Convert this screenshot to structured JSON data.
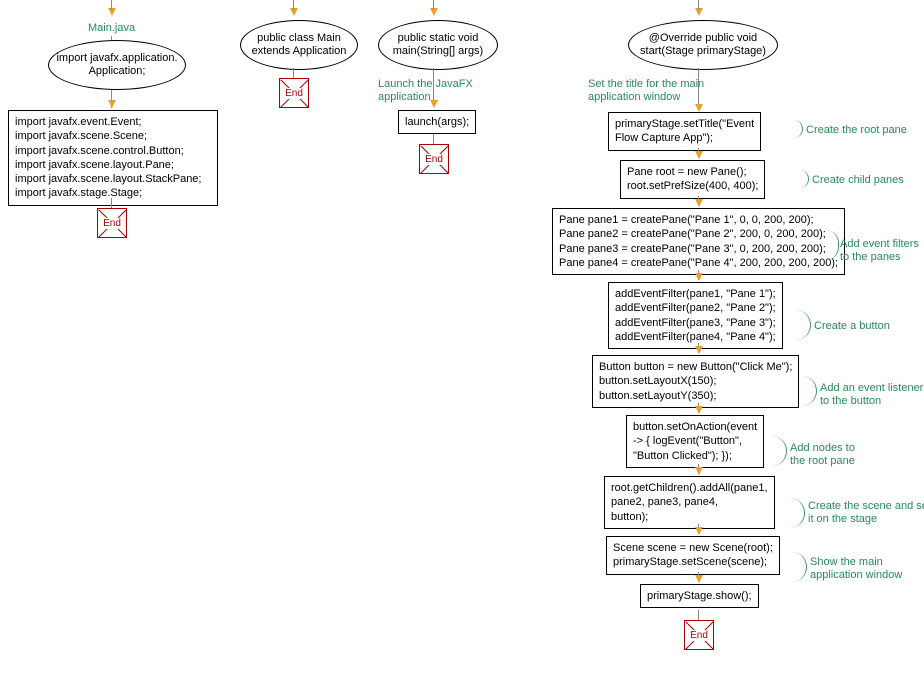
{
  "columns": {
    "col1": {
      "title": "Main.java",
      "ellipse": "import javafx.application.\nApplication;",
      "box": "import javafx.event.Event;\nimport javafx.scene.Scene;\nimport javafx.scene.control.Button;\nimport javafx.scene.layout.Pane;\nimport javafx.scene.layout.StackPane;\nimport javafx.stage.Stage;",
      "end": "End"
    },
    "col2": {
      "ellipse": "public class Main\nextends Application",
      "end": "End"
    },
    "col3": {
      "ellipse": "public static void\nmain(String[] args)",
      "comment": "Launch the JavaFX\napplication",
      "box": "launch(args);",
      "end": "End"
    },
    "col4": {
      "ellipse": "@Override public void\nstart(Stage primaryStage)",
      "c1": "Set the title for the main\napplication window",
      "b1": "primaryStage.setTitle(\"Event\nFlow Capture App\");",
      "c2": "Create the root pane",
      "b2": "Pane root = new Pane();\nroot.setPrefSize(400, 400);",
      "c3": "Create child panes",
      "b3": "Pane pane1 = createPane(\"Pane 1\", 0, 0, 200, 200);\nPane pane2 = createPane(\"Pane 2\", 200, 0, 200, 200);\nPane pane3 = createPane(\"Pane 3\", 0, 200, 200, 200);\nPane pane4 = createPane(\"Pane 4\", 200, 200, 200, 200);",
      "c4": "Add event filters\nto the panes",
      "b4": "addEventFilter(pane1, \"Pane 1\");\naddEventFilter(pane2, \"Pane 2\");\naddEventFilter(pane3, \"Pane 3\");\naddEventFilter(pane4, \"Pane 4\");",
      "c5": "Create a button",
      "b5": "Button button = new Button(\"Click Me\");\nbutton.setLayoutX(150);\nbutton.setLayoutY(350);",
      "c6": "Add an event listener\nto the button",
      "b6": "button.setOnAction(event\n-> { logEvent(\"Button\",\n\"Button Clicked\"); });",
      "c7": "Add nodes to\nthe root pane",
      "b7": "root.getChildren().addAll(pane1,\npane2, pane3, pane4,\nbutton);",
      "c8": "Create the scene and set\nit on the stage",
      "b8": "Scene scene = new Scene(root);\nprimaryStage.setScene(scene);",
      "c9": "Show the main\napplication window",
      "b9": "primaryStage.show();",
      "end": "End"
    }
  }
}
